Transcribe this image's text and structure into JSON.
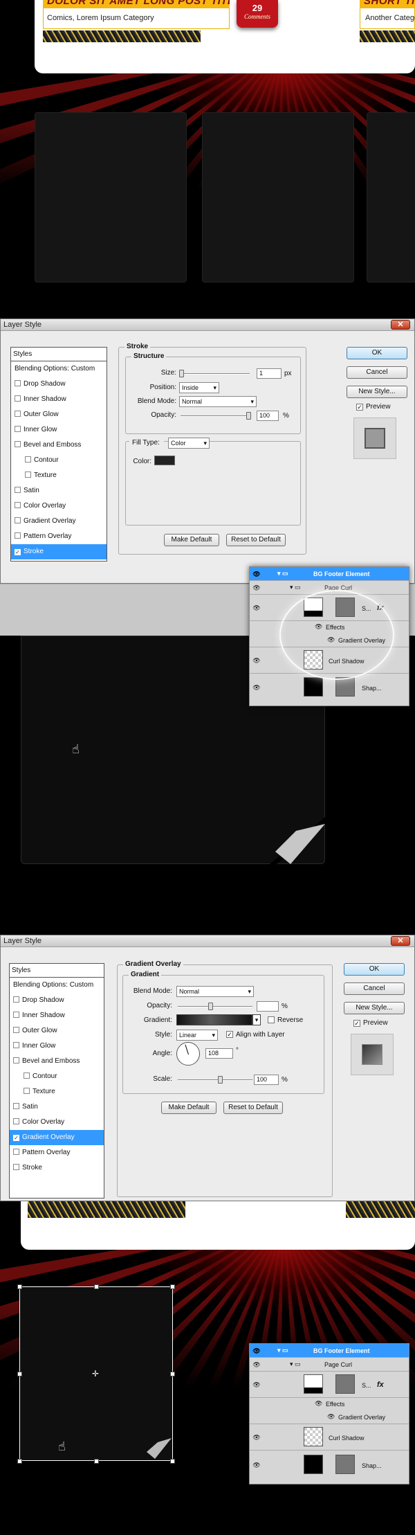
{
  "webpage": {
    "posts": [
      {
        "title": "DOLOR SIT AMET LONG POST TITLE",
        "category": "Comics, Lorem Ipsum Category",
        "comments_count": "29",
        "comments_label": "Comments"
      },
      {
        "title": "SHORT TITLE",
        "category": "Another Category"
      }
    ]
  },
  "stroke_dialog": {
    "title": "Layer Style",
    "styles_header": "Styles",
    "style_items": [
      "Blending Options: Custom",
      "Drop Shadow",
      "Inner Shadow",
      "Outer Glow",
      "Inner Glow",
      "Bevel and Emboss",
      "Contour",
      "Texture",
      "Satin",
      "Color Overlay",
      "Gradient Overlay",
      "Pattern Overlay",
      "Stroke"
    ],
    "section_title": "Stroke",
    "structure_title": "Structure",
    "size_label": "Size:",
    "size_value": "1",
    "size_unit": "px",
    "position_label": "Position:",
    "position_value": "Inside",
    "blend_mode_label": "Blend Mode:",
    "blend_mode_value": "Normal",
    "opacity_label": "Opacity:",
    "opacity_value": "100",
    "opacity_unit": "%",
    "fill_type_label": "Fill Type:",
    "fill_type_value": "Color",
    "color_label": "Color:",
    "make_default": "Make Default",
    "reset_default": "Reset to Default",
    "ok": "OK",
    "cancel": "Cancel",
    "new_style": "New Style...",
    "preview": "Preview"
  },
  "layers_panel_1": {
    "rows": [
      "BG Footer Element",
      "Page Curl",
      "S...",
      "Effects",
      "Gradient Overlay",
      "Curl Shadow",
      "Shap..."
    ],
    "fx": "fx"
  },
  "gradient_dialog": {
    "title": "Layer Style",
    "styles_header": "Styles",
    "style_items": [
      "Blending Options: Custom",
      "Drop Shadow",
      "Inner Shadow",
      "Outer Glow",
      "Inner Glow",
      "Bevel and Emboss",
      "Contour",
      "Texture",
      "Satin",
      "Color Overlay",
      "Gradient Overlay",
      "Pattern Overlay",
      "Stroke"
    ],
    "section_title": "Gradient Overlay",
    "gradient_title": "Gradient",
    "blend_mode_label": "Blend Mode:",
    "blend_mode_value": "Normal",
    "opacity_label": "Opacity:",
    "opacity_value": "",
    "opacity_unit": "%",
    "gradient_label": "Gradient:",
    "reverse_label": "Reverse",
    "style_label": "Style:",
    "style_value": "Linear",
    "align_label": "Align with Layer",
    "angle_label": "Angle:",
    "angle_value": "108",
    "angle_unit": "°",
    "scale_label": "Scale:",
    "scale_value": "100",
    "scale_unit": "%",
    "make_default": "Make Default",
    "reset_default": "Reset to Default",
    "ok": "OK",
    "cancel": "Cancel",
    "new_style": "New Style...",
    "preview": "Preview"
  },
  "layers_panel_2": {
    "rows": [
      "BG Footer Element",
      "Page Curl",
      "S...",
      "Effects",
      "Gradient Overlay",
      "Curl Shadow",
      "Shap..."
    ],
    "fx": "fx"
  },
  "colors": {
    "accent_red": "#c0151c",
    "title_yellow": "#f7b711",
    "selection_blue": "#3399ff"
  }
}
